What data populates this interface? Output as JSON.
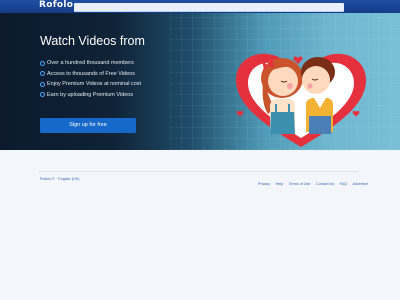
{
  "brand": {
    "logo_text": "Rofolo",
    "primary_color": "#1f4fa3",
    "button_color": "#1769c9",
    "check_color": "#4ba8ff"
  },
  "hero": {
    "title": "Watch Videos from",
    "features": [
      "Over a hundred thousand members",
      "Access to thousands of Free Videos",
      "Enjoy Premium Videos at nominal cost",
      "Earn by uploading Premium Videos"
    ],
    "signup_label": "Sign up for free"
  },
  "footer": {
    "locale": "Rofolo © · English (UK)",
    "links": [
      "Privacy",
      "Help",
      "Terms of Use",
      "Contact Us",
      "FAQ",
      "Advertise"
    ]
  }
}
